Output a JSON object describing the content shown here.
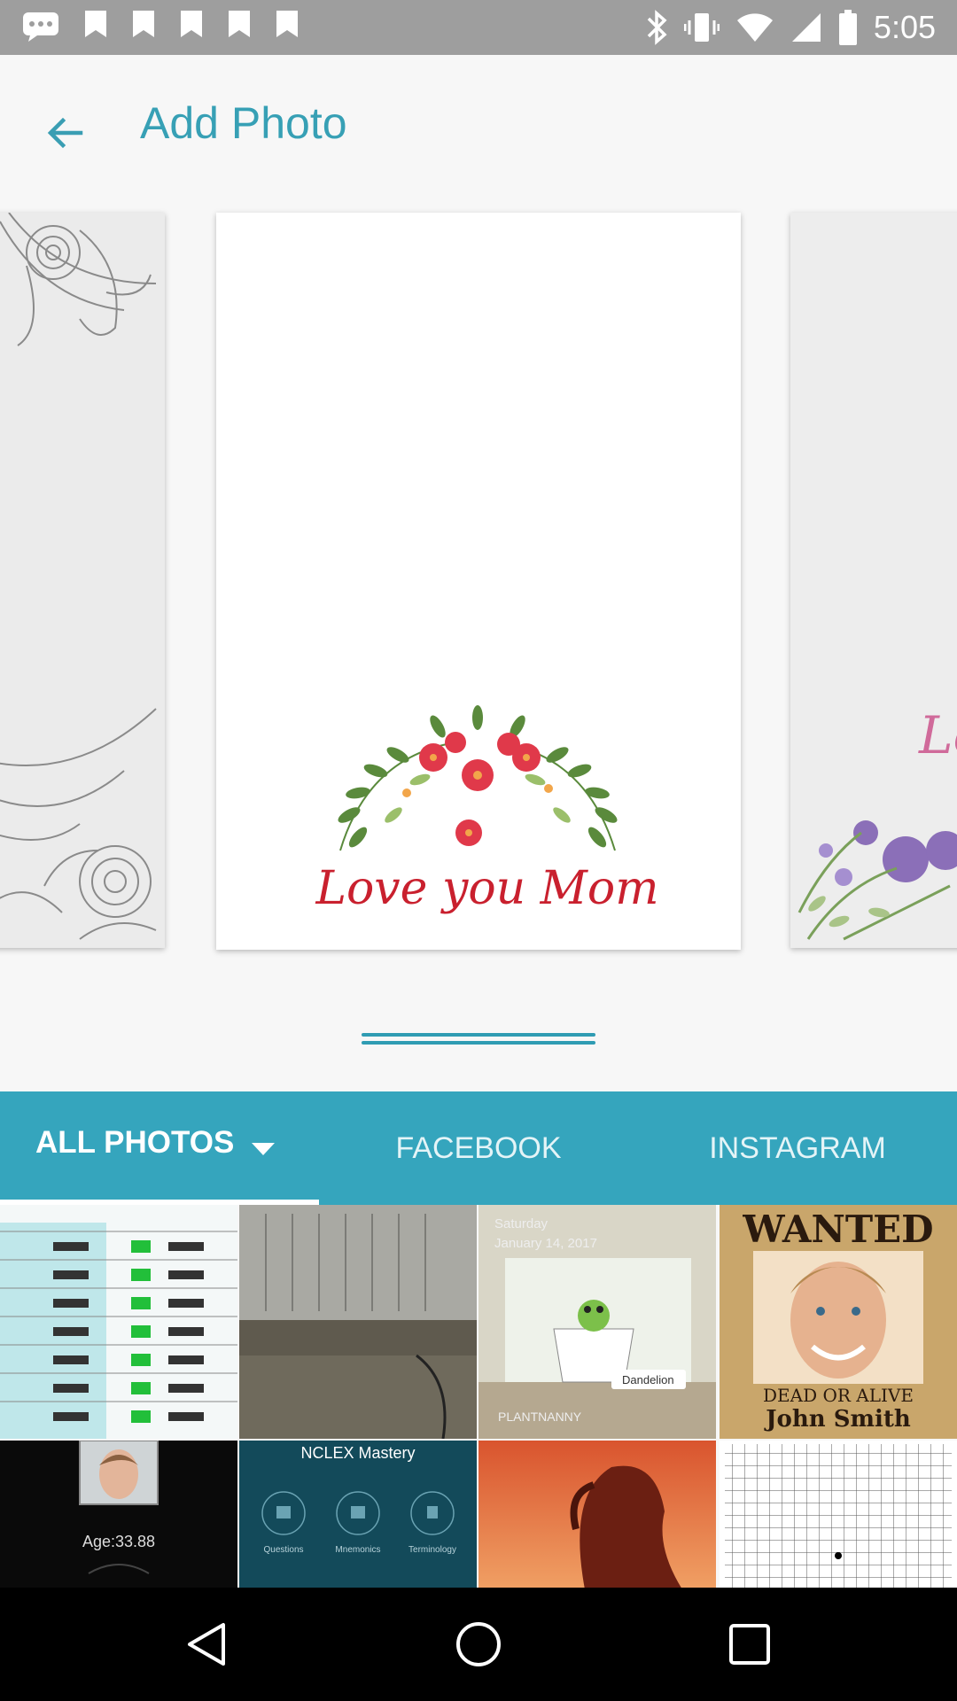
{
  "status_bar": {
    "time": "5:05",
    "left_icons": [
      "message-icon",
      "notification-icon",
      "notification-icon",
      "notification-icon",
      "notification-icon",
      "notification-icon"
    ],
    "right_icons": [
      "bluetooth-icon",
      "vibrate-icon",
      "wifi-icon",
      "signal-icon",
      "battery-icon"
    ]
  },
  "header": {
    "title": "Add Photo",
    "back_icon": "arrow-back-icon"
  },
  "carousel": {
    "center_card_text": "Love you Mom",
    "right_card_partial_text": "Lo"
  },
  "tabs": [
    {
      "label": "ALL PHOTOS",
      "selected": true
    },
    {
      "label": "FACEBOOK",
      "selected": false
    },
    {
      "label": "INSTAGRAM",
      "selected": false
    }
  ],
  "gallery": {
    "plant_card_date_line1": "Saturday",
    "plant_card_date_line2": "January 14, 2017",
    "plant_card_tag": "Dandelion",
    "plant_card_brand": "PLANTNANNY",
    "wanted_title": "WANTED",
    "wanted_subtitle": "DEAD OR ALIVE",
    "wanted_name": "John Smith",
    "age_label": "Age:33.88",
    "nclex_title": "NCLEX Mastery",
    "nclex_items": [
      "Questions",
      "Mnemonics",
      "Terminology"
    ]
  },
  "colors": {
    "accent": "#35a5bd",
    "title": "#37a0b5",
    "status_bar": "#9e9e9e",
    "nav_bar": "#000000"
  },
  "nav_bar": {
    "icons": [
      "back-triangle-icon",
      "home-circle-icon",
      "recents-square-icon"
    ]
  }
}
